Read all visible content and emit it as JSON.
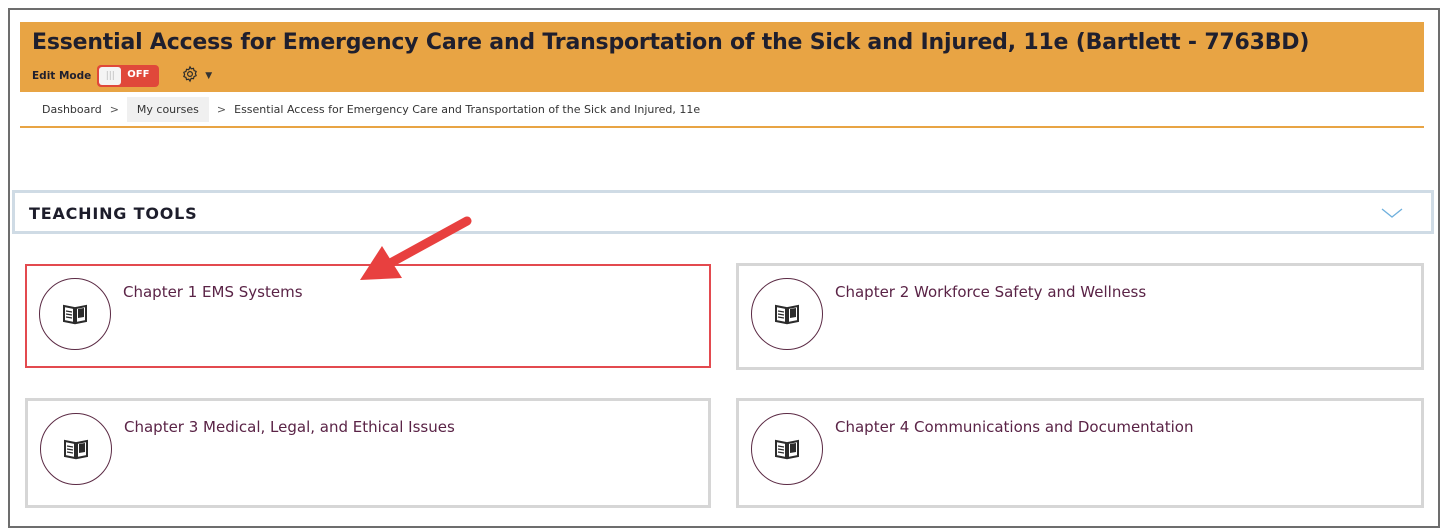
{
  "header": {
    "title": "Essential Access for Emergency Care and Transportation of the Sick and Injured, 11e (Bartlett - 7763BD)",
    "edit_mode_label": "Edit Mode",
    "toggle_state": "OFF",
    "toggle_knob_glyph": "|||"
  },
  "breadcrumb": {
    "items": [
      "Dashboard",
      "My courses",
      "Essential Access for Emergency Care and Transportation of the Sick and Injured, 11e"
    ],
    "separator": ">"
  },
  "section": {
    "title": "TEACHING TOOLS"
  },
  "cards": [
    {
      "title": "Chapter 1 EMS Systems",
      "icon": "book-open-icon",
      "highlighted": true
    },
    {
      "title": "Chapter 2 Workforce Safety and Wellness",
      "icon": "book-open-icon",
      "highlighted": false
    },
    {
      "title": "Chapter 3 Medical, Legal, and Ethical Issues",
      "icon": "book-open-icon",
      "highlighted": false
    },
    {
      "title": "Chapter 4 Communications and Documentation",
      "icon": "book-open-icon",
      "highlighted": false
    }
  ],
  "colors": {
    "header_bg": "#e8a444",
    "toggle_off": "#e0483a",
    "card_text": "#5a2346",
    "highlight_border": "#e34a4f",
    "annotation_arrow": "#e8403f"
  }
}
